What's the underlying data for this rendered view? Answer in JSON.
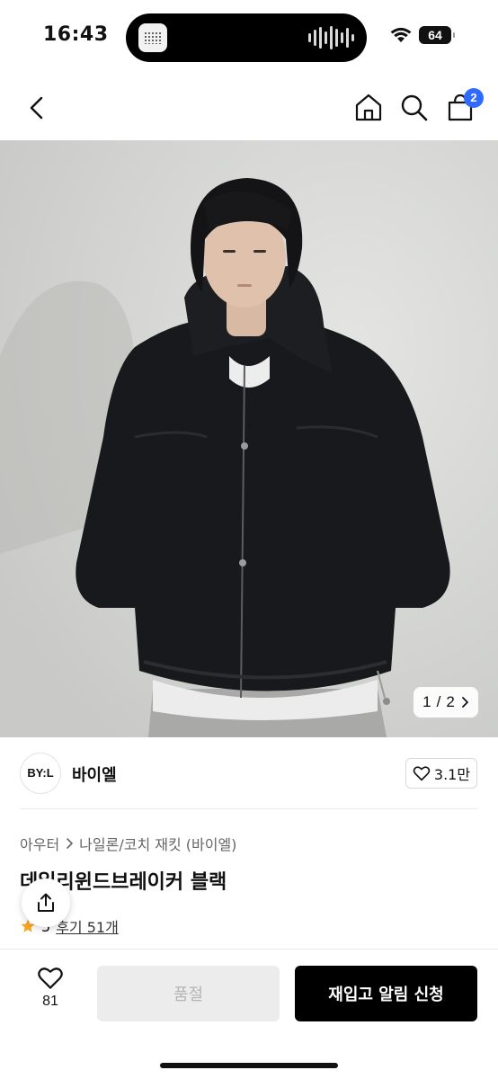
{
  "status_bar": {
    "time": "16:43",
    "battery": "64",
    "icons": [
      "wifi-icon",
      "battery-icon"
    ]
  },
  "nav": {
    "icons": [
      "back-chevron-icon",
      "home-icon",
      "search-icon",
      "cart-icon"
    ],
    "cart_badge": "2"
  },
  "gallery": {
    "current": "1",
    "separator": "/",
    "total": "2",
    "icon": "chevron-right-icon"
  },
  "brand": {
    "logo_text": "BY:L",
    "name": "바이엘",
    "likes": "3.1만"
  },
  "product": {
    "category_1": "아우터",
    "category_2": "나일론/코치 재킷 (바이엘)",
    "title": "데일리윈드브레이커 블랙",
    "rating": "5",
    "reviews": "후기 51개"
  },
  "actions": {
    "wish_count": "81",
    "soldout_label": "품절",
    "restock_label": "재입고 알림 신청"
  },
  "colors": {
    "accent_badge": "#2f6bff",
    "primary_button": "#000000",
    "disabled_button": "#ececec",
    "star": "#f5a623"
  }
}
